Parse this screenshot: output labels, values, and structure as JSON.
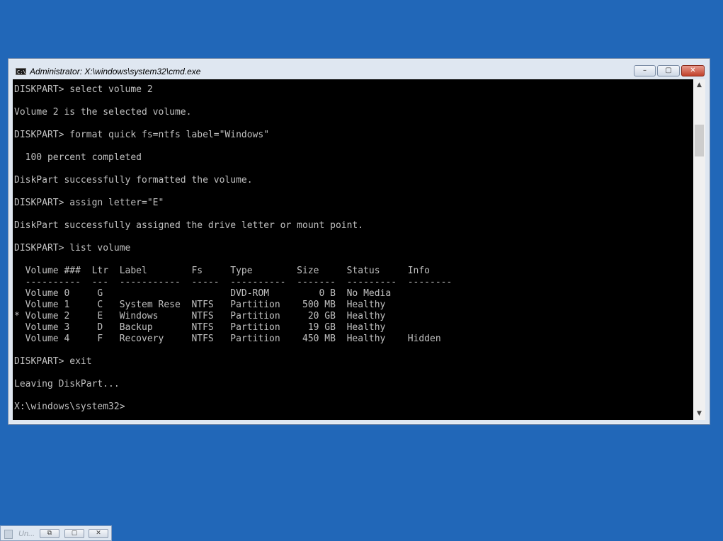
{
  "window": {
    "title": "Administrator: X:\\windows\\system32\\cmd.exe",
    "icon_text": "C:\\.",
    "controls": {
      "minimize": "–",
      "maximize": "▢",
      "close": "✕"
    }
  },
  "console": {
    "lines": [
      "DISKPART> select volume 2",
      "",
      "Volume 2 is the selected volume.",
      "",
      "DISKPART> format quick fs=ntfs label=\"Windows\"",
      "",
      "  100 percent completed",
      "",
      "DiskPart successfully formatted the volume.",
      "",
      "DISKPART> assign letter=\"E\"",
      "",
      "DiskPart successfully assigned the drive letter or mount point.",
      "",
      "DISKPART> list volume",
      "",
      "  Volume ###  Ltr  Label        Fs     Type        Size     Status     Info",
      "  ----------  ---  -----------  -----  ----------  -------  ---------  --------",
      "  Volume 0     G                       DVD-ROM         0 B  No Media",
      "  Volume 1     C   System Rese  NTFS   Partition    500 MB  Healthy",
      "* Volume 2     E   Windows      NTFS   Partition     20 GB  Healthy",
      "  Volume 3     D   Backup       NTFS   Partition     19 GB  Healthy",
      "  Volume 4     F   Recovery     NTFS   Partition    450 MB  Healthy    Hidden",
      "",
      "DISKPART> exit",
      "",
      "Leaving DiskPart...",
      "",
      "X:\\windows\\system32>"
    ]
  },
  "scrollbar": {
    "up_arrow": "▲",
    "down_arrow": "▼"
  },
  "taskbar_item": {
    "title": "Un...",
    "buttons": {
      "restore": "⧉",
      "maximize": "▢",
      "close": "✕"
    }
  }
}
